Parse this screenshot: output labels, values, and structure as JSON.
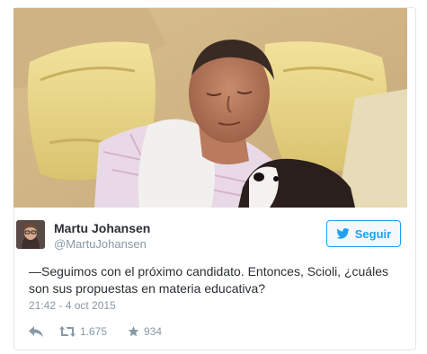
{
  "tweet": {
    "author": {
      "display_name": "Martu Johansen",
      "handle": "@MartuJohansen"
    },
    "follow_label": "Seguir",
    "text": "—Seguimos con el próximo candidato. Entonces, Scioli, ¿cuáles son sus propuestas en materia educativa?",
    "timestamp": "21:42 - 4 oct 2015",
    "retweet_count": "1.675",
    "like_count": "934"
  },
  "icons": {
    "follow": "bird-icon",
    "reply": "reply-icon",
    "retweet": "retweet-icon",
    "like": "star-icon"
  },
  "colors": {
    "accent": "#1da1f2",
    "text": "#292f33",
    "muted": "#8899a6",
    "border": "#e1e8ed"
  }
}
